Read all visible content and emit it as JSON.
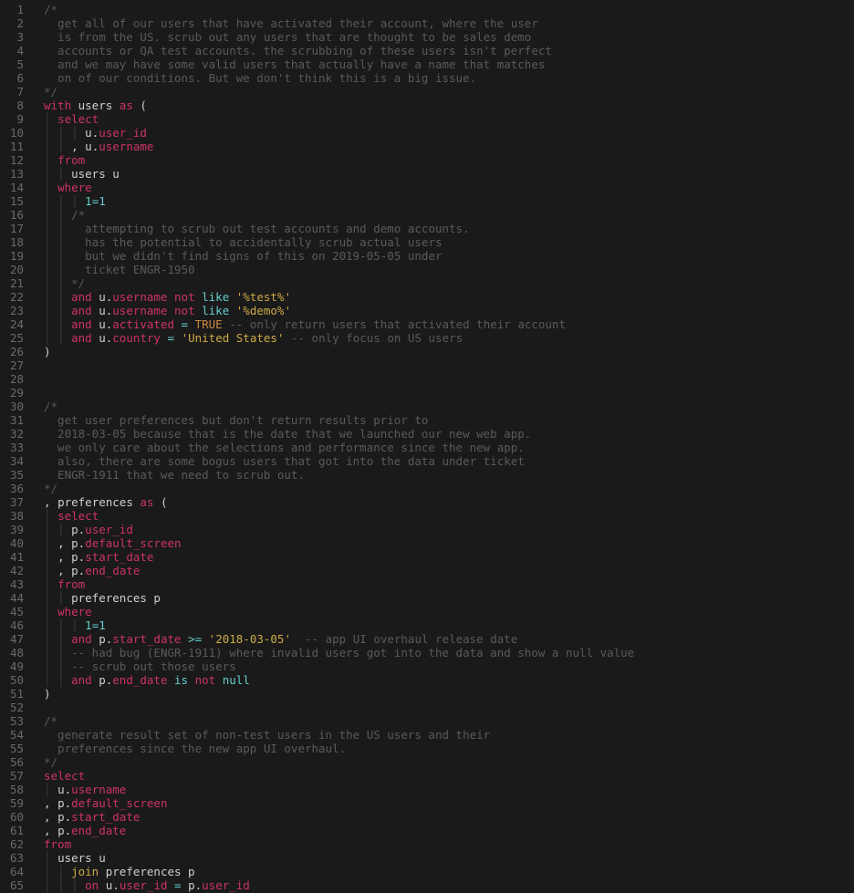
{
  "editor": {
    "line_count": 65,
    "lines": [
      [
        [
          "comment",
          "/*"
        ]
      ],
      [
        [
          "comment",
          "  get all of our users that have activated their account, where the user"
        ]
      ],
      [
        [
          "comment",
          "  is from the US. scrub out any users that are thought to be sales demo"
        ]
      ],
      [
        [
          "comment",
          "  accounts or QA test accounts. the scrubbing of these users isn't perfect"
        ]
      ],
      [
        [
          "comment",
          "  and we may have some valid users that actually have a name that matches"
        ]
      ],
      [
        [
          "comment",
          "  on of our conditions. But we don't think this is a big issue."
        ]
      ],
      [
        [
          "comment",
          "*/"
        ]
      ],
      [
        [
          "keyword",
          "with"
        ],
        [
          "ident",
          " users "
        ],
        [
          "keyword",
          "as"
        ],
        [
          "punct",
          " ("
        ]
      ],
      [
        [
          "indent",
          "| "
        ],
        [
          "keyword",
          "select"
        ]
      ],
      [
        [
          "indent",
          "| | | "
        ],
        [
          "ident",
          "u"
        ],
        [
          "punct",
          "."
        ],
        [
          "col",
          "user_id"
        ]
      ],
      [
        [
          "indent",
          "| | "
        ],
        [
          "punct",
          ", "
        ],
        [
          "ident",
          "u"
        ],
        [
          "punct",
          "."
        ],
        [
          "col",
          "username"
        ]
      ],
      [
        [
          "indent",
          "| "
        ],
        [
          "keyword",
          "from"
        ]
      ],
      [
        [
          "indent",
          "| | "
        ],
        [
          "ident",
          "users u"
        ]
      ],
      [
        [
          "indent",
          "| "
        ],
        [
          "keyword",
          "where"
        ]
      ],
      [
        [
          "indent",
          "| | | "
        ],
        [
          "num",
          "1"
        ],
        [
          "op",
          "="
        ],
        [
          "num",
          "1"
        ]
      ],
      [
        [
          "indent",
          "| | "
        ],
        [
          "comment",
          "/*"
        ]
      ],
      [
        [
          "indent",
          "| | "
        ],
        [
          "comment",
          "  attempting to scrub out test accounts and demo accounts."
        ]
      ],
      [
        [
          "indent",
          "| | "
        ],
        [
          "comment",
          "  has the potential to accidentally scrub actual users"
        ]
      ],
      [
        [
          "indent",
          "| | "
        ],
        [
          "comment",
          "  but we didn't find signs of this on 2019-05-05 under"
        ]
      ],
      [
        [
          "indent",
          "| | "
        ],
        [
          "comment",
          "  ticket ENGR-1950"
        ]
      ],
      [
        [
          "indent",
          "| | "
        ],
        [
          "comment",
          "*/"
        ]
      ],
      [
        [
          "indent",
          "| | "
        ],
        [
          "keyword",
          "and"
        ],
        [
          "ident",
          " u"
        ],
        [
          "punct",
          "."
        ],
        [
          "col",
          "username "
        ],
        [
          "keyword",
          "not"
        ],
        [
          "ident",
          " "
        ],
        [
          "not",
          "like "
        ],
        [
          "str",
          "'%test%'"
        ]
      ],
      [
        [
          "indent",
          "| | "
        ],
        [
          "keyword",
          "and"
        ],
        [
          "ident",
          " u"
        ],
        [
          "punct",
          "."
        ],
        [
          "col",
          "username "
        ],
        [
          "keyword",
          "not"
        ],
        [
          "ident",
          " "
        ],
        [
          "not",
          "like "
        ],
        [
          "str",
          "'%demo%'"
        ]
      ],
      [
        [
          "indent",
          "| | "
        ],
        [
          "keyword",
          "and"
        ],
        [
          "ident",
          " u"
        ],
        [
          "punct",
          "."
        ],
        [
          "col",
          "activated"
        ],
        [
          "ident",
          " "
        ],
        [
          "op",
          "="
        ],
        [
          "ident",
          " "
        ],
        [
          "const",
          "TRUE"
        ],
        [
          "comment",
          " -- only return users that activated their account"
        ]
      ],
      [
        [
          "indent",
          "| | "
        ],
        [
          "keyword",
          "and"
        ],
        [
          "ident",
          " u"
        ],
        [
          "punct",
          "."
        ],
        [
          "col",
          "country"
        ],
        [
          "ident",
          " "
        ],
        [
          "op",
          "="
        ],
        [
          "ident",
          " "
        ],
        [
          "str",
          "'United States'"
        ],
        [
          "comment",
          " -- only focus on US users"
        ]
      ],
      [
        [
          "punct",
          ")"
        ]
      ],
      [],
      [],
      [],
      [
        [
          "comment",
          "/*"
        ]
      ],
      [
        [
          "comment",
          "  get user preferences but don't return results prior to"
        ]
      ],
      [
        [
          "comment",
          "  2018-03-05 because that is the date that we launched our new web app."
        ]
      ],
      [
        [
          "comment",
          "  we only care about the selections and performance since the new app."
        ]
      ],
      [
        [
          "comment",
          "  also, there are some bogus users that got into the data under ticket"
        ]
      ],
      [
        [
          "comment",
          "  ENGR-1911 that we need to scrub out."
        ]
      ],
      [
        [
          "comment",
          "*/"
        ]
      ],
      [
        [
          "punct",
          ", "
        ],
        [
          "ident",
          "preferences "
        ],
        [
          "keyword",
          "as"
        ],
        [
          "punct",
          " ("
        ]
      ],
      [
        [
          "indent",
          "| "
        ],
        [
          "keyword",
          "select"
        ]
      ],
      [
        [
          "indent",
          "| | "
        ],
        [
          "ident",
          "p"
        ],
        [
          "punct",
          "."
        ],
        [
          "col",
          "user_id"
        ]
      ],
      [
        [
          "indent",
          "| "
        ],
        [
          "punct",
          ", "
        ],
        [
          "ident",
          "p"
        ],
        [
          "punct",
          "."
        ],
        [
          "col",
          "default_screen"
        ]
      ],
      [
        [
          "indent",
          "| "
        ],
        [
          "punct",
          ", "
        ],
        [
          "ident",
          "p"
        ],
        [
          "punct",
          "."
        ],
        [
          "col",
          "start_date"
        ]
      ],
      [
        [
          "indent",
          "| "
        ],
        [
          "punct",
          ", "
        ],
        [
          "ident",
          "p"
        ],
        [
          "punct",
          "."
        ],
        [
          "col",
          "end_date"
        ]
      ],
      [
        [
          "indent",
          "| "
        ],
        [
          "keyword",
          "from"
        ]
      ],
      [
        [
          "indent",
          "| | "
        ],
        [
          "ident",
          "preferences p"
        ]
      ],
      [
        [
          "indent",
          "| "
        ],
        [
          "keyword",
          "where"
        ]
      ],
      [
        [
          "indent",
          "| | | "
        ],
        [
          "num",
          "1"
        ],
        [
          "op",
          "="
        ],
        [
          "num",
          "1"
        ]
      ],
      [
        [
          "indent",
          "| | "
        ],
        [
          "keyword",
          "and"
        ],
        [
          "ident",
          " p"
        ],
        [
          "punct",
          "."
        ],
        [
          "col",
          "start_date"
        ],
        [
          "ident",
          " "
        ],
        [
          "op",
          ">="
        ],
        [
          "ident",
          " "
        ],
        [
          "str",
          "'2018-03-05'"
        ],
        [
          "comment",
          "  -- app UI overhaul release date"
        ]
      ],
      [
        [
          "indent",
          "| | "
        ],
        [
          "comment",
          "-- had bug (ENGR-1911) where invalid users got into the data and show a null value"
        ]
      ],
      [
        [
          "indent",
          "| | "
        ],
        [
          "comment",
          "-- scrub out those users"
        ]
      ],
      [
        [
          "indent",
          "| | "
        ],
        [
          "keyword",
          "and"
        ],
        [
          "ident",
          " p"
        ],
        [
          "punct",
          "."
        ],
        [
          "col",
          "end_date"
        ],
        [
          "ident",
          " "
        ],
        [
          "not",
          "is"
        ],
        [
          "ident",
          " "
        ],
        [
          "keyword",
          "not"
        ],
        [
          "ident",
          " "
        ],
        [
          "not",
          "null"
        ]
      ],
      [
        [
          "punct",
          ")"
        ]
      ],
      [],
      [
        [
          "comment",
          "/*"
        ]
      ],
      [
        [
          "comment",
          "  generate result set of non-test users in the US users and their"
        ]
      ],
      [
        [
          "comment",
          "  preferences since the new app UI overhaul."
        ]
      ],
      [
        [
          "comment",
          "*/"
        ]
      ],
      [
        [
          "keyword",
          "select"
        ]
      ],
      [
        [
          "indent",
          "| "
        ],
        [
          "ident",
          "u"
        ],
        [
          "punct",
          "."
        ],
        [
          "col",
          "username"
        ]
      ],
      [
        [
          "punct",
          ", "
        ],
        [
          "ident",
          "p"
        ],
        [
          "punct",
          "."
        ],
        [
          "col",
          "default_screen"
        ]
      ],
      [
        [
          "punct",
          ", "
        ],
        [
          "ident",
          "p"
        ],
        [
          "punct",
          "."
        ],
        [
          "col",
          "start_date"
        ]
      ],
      [
        [
          "punct",
          ", "
        ],
        [
          "ident",
          "p"
        ],
        [
          "punct",
          "."
        ],
        [
          "col",
          "end_date"
        ]
      ],
      [
        [
          "keyword",
          "from"
        ]
      ],
      [
        [
          "indent",
          "| "
        ],
        [
          "ident",
          "users u"
        ]
      ],
      [
        [
          "indent",
          "| | "
        ],
        [
          "join",
          "join"
        ],
        [
          "ident",
          " preferences p"
        ]
      ],
      [
        [
          "indent",
          "| | | "
        ],
        [
          "keyword",
          "on"
        ],
        [
          "ident",
          " u"
        ],
        [
          "punct",
          "."
        ],
        [
          "col",
          "user_id"
        ],
        [
          "ident",
          " "
        ],
        [
          "op",
          "="
        ],
        [
          "ident",
          " p"
        ],
        [
          "punct",
          "."
        ],
        [
          "col",
          "user_id"
        ]
      ]
    ]
  }
}
